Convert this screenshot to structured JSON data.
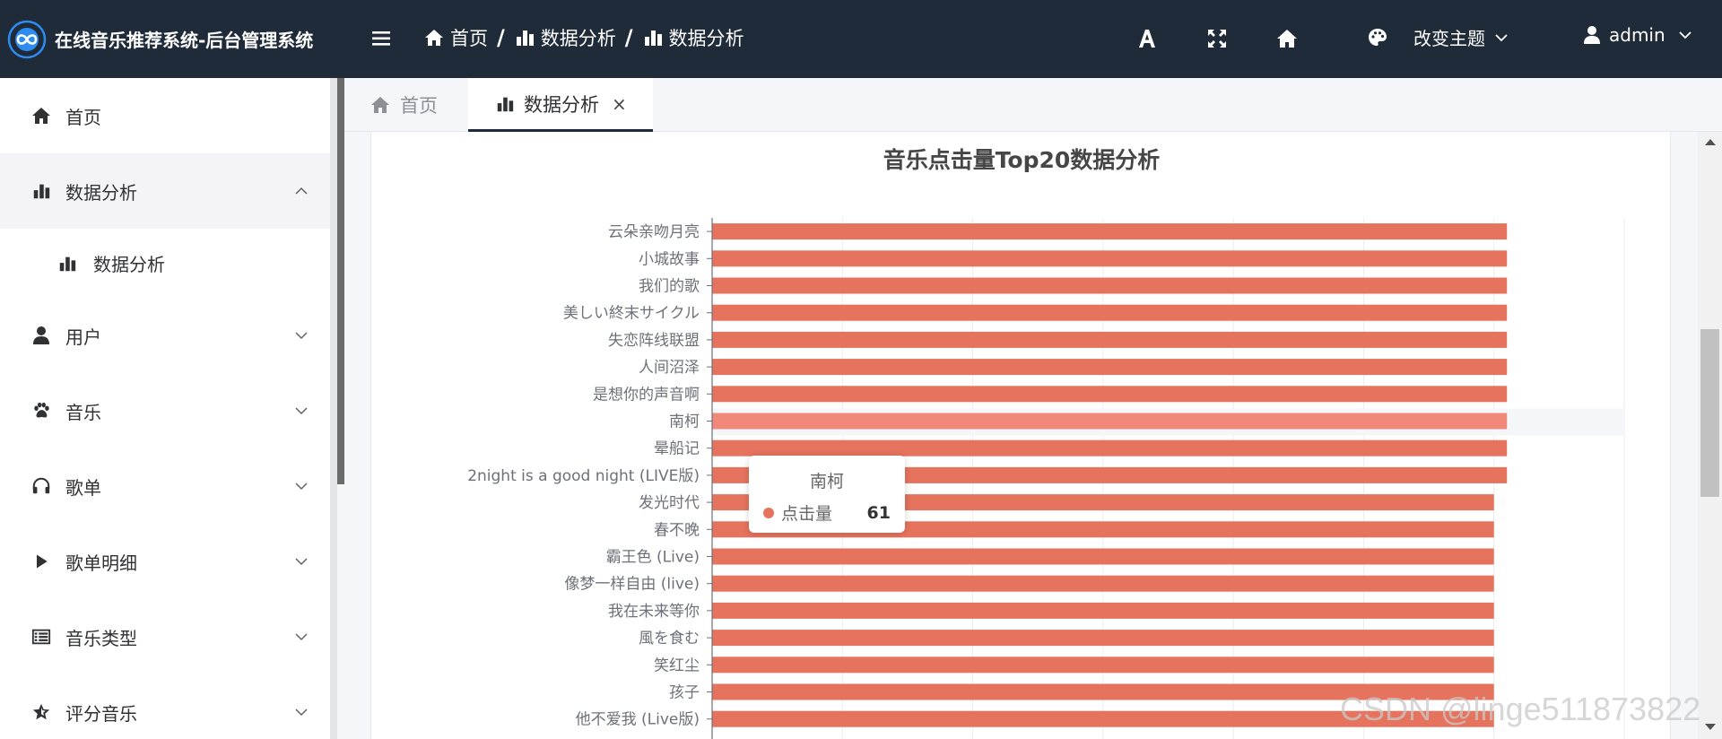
{
  "app": {
    "title": "在线音乐推荐系统-后台管理系统"
  },
  "breadcrumb": [
    {
      "label": "首页",
      "icon": "home-icon"
    },
    {
      "label": "数据分析",
      "icon": "bar-chart-icon"
    },
    {
      "label": "数据分析",
      "icon": "bar-chart-icon"
    }
  ],
  "header": {
    "theme_label": "改变主题",
    "user_label": "admin"
  },
  "sidebar": {
    "items": [
      {
        "label": "首页",
        "icon": "home-icon"
      },
      {
        "label": "数据分析",
        "icon": "bar-chart-icon",
        "expanded": true
      },
      {
        "label": "数据分析",
        "icon": "bar-chart-icon"
      },
      {
        "label": "用户",
        "icon": "user-icon"
      },
      {
        "label": "音乐",
        "icon": "paw-icon"
      },
      {
        "label": "歌单",
        "icon": "headphones-icon"
      },
      {
        "label": "歌单明细",
        "icon": "play-icon"
      },
      {
        "label": "音乐类型",
        "icon": "list-icon"
      },
      {
        "label": "评分音乐",
        "icon": "star-icon"
      }
    ]
  },
  "tabs": [
    {
      "label": "首页"
    },
    {
      "label": "数据分析",
      "close": "×"
    }
  ],
  "tooltip": {
    "title": "南柯",
    "series": "点击量",
    "value": "61"
  },
  "watermark": "CSDN @linge511873822",
  "colors": {
    "header_bg": "#202b3a",
    "bar": "#e5735e",
    "bar_highlight": "#f0897a",
    "logo": "#2d8cf0"
  },
  "chart_data": {
    "type": "bar",
    "orientation": "horizontal",
    "title": "音乐点击量Top20数据分析",
    "categories": [
      "云朵亲吻月亮",
      "小城故事",
      "我们的歌",
      "美しい終末サイクル",
      "失恋阵线联盟",
      "人间沼泽",
      "是想你的声音啊",
      "南柯",
      "晕船记",
      "2night is a good night (LIVE版)",
      "发光时代",
      "春不晚",
      "霸王色 (Live)",
      "像梦一样自由 (live)",
      "我在未来等你",
      "風を食む",
      "笑红尘",
      "孩子",
      "他不爱我 (Live版)"
    ],
    "series": [
      {
        "name": "点击量",
        "values": [
          61,
          61,
          61,
          61,
          61,
          61,
          61,
          61,
          61,
          61,
          60,
          60,
          60,
          60,
          60,
          60,
          60,
          60,
          60
        ]
      }
    ],
    "xlim": [
      0,
      70
    ],
    "highlighted": "南柯",
    "grid": true
  }
}
